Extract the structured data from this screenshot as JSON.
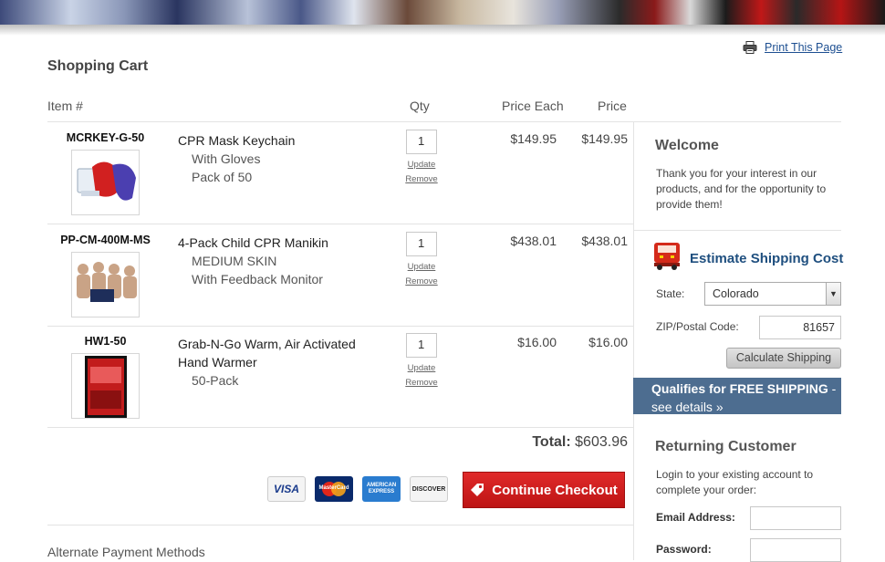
{
  "toolbar": {
    "print_label": "Print This Page"
  },
  "cart": {
    "title": "Shopping Cart",
    "headers": {
      "item": "Item #",
      "qty": "Qty",
      "price_each": "Price Each",
      "price": "Price"
    },
    "items": [
      {
        "sku": "MCRKEY-G-50",
        "name": "CPR Mask Keychain",
        "options": [
          "With Gloves",
          "Pack of 50"
        ],
        "qty": "1",
        "price_each": "$149.95",
        "price": "$149.95"
      },
      {
        "sku": "PP-CM-400M-MS",
        "name": "4-Pack Child CPR Manikin",
        "options": [
          "MEDIUM SKIN",
          "With Feedback Monitor"
        ],
        "qty": "1",
        "price_each": "$438.01",
        "price": "$438.01"
      },
      {
        "sku": "HW1-50",
        "name": "Grab-N-Go Warm, Air Activated Hand Warmer",
        "options": [
          "50-Pack"
        ],
        "qty": "1",
        "price_each": "$16.00",
        "price": "$16.00"
      }
    ],
    "update_label": "Update",
    "remove_label": "Remove",
    "total_label": "Total:",
    "total_value": "$603.96",
    "cards": [
      "VISA",
      "MasterCard",
      "AMERICAN EXPRESS",
      "DISCOVER"
    ],
    "checkout_label": "Continue Checkout",
    "alt_payment": "Alternate Payment Methods"
  },
  "sidebar": {
    "welcome_title": "Welcome",
    "welcome_text": "Thank you for your interest in our products, and for the opportunity to provide them!",
    "shipping_title": "Estimate Shipping Cost",
    "state_label": "State:",
    "state_value": "Colorado",
    "zip_label": "ZIP/Postal Code:",
    "zip_value": "81657",
    "calc_label": "Calculate Shipping",
    "free_shipping_bold": "Qualifies for FREE SHIPPING",
    "free_shipping_link": " - see details »",
    "returning_title": "Returning Customer",
    "returning_text": "Login to your existing account to complete your order:",
    "email_label": "Email Address:",
    "password_label": "Password:"
  },
  "colors": {
    "accent_red": "#c81a1a",
    "link_blue": "#1d4f91",
    "banner_blue": "#4d6d90"
  }
}
